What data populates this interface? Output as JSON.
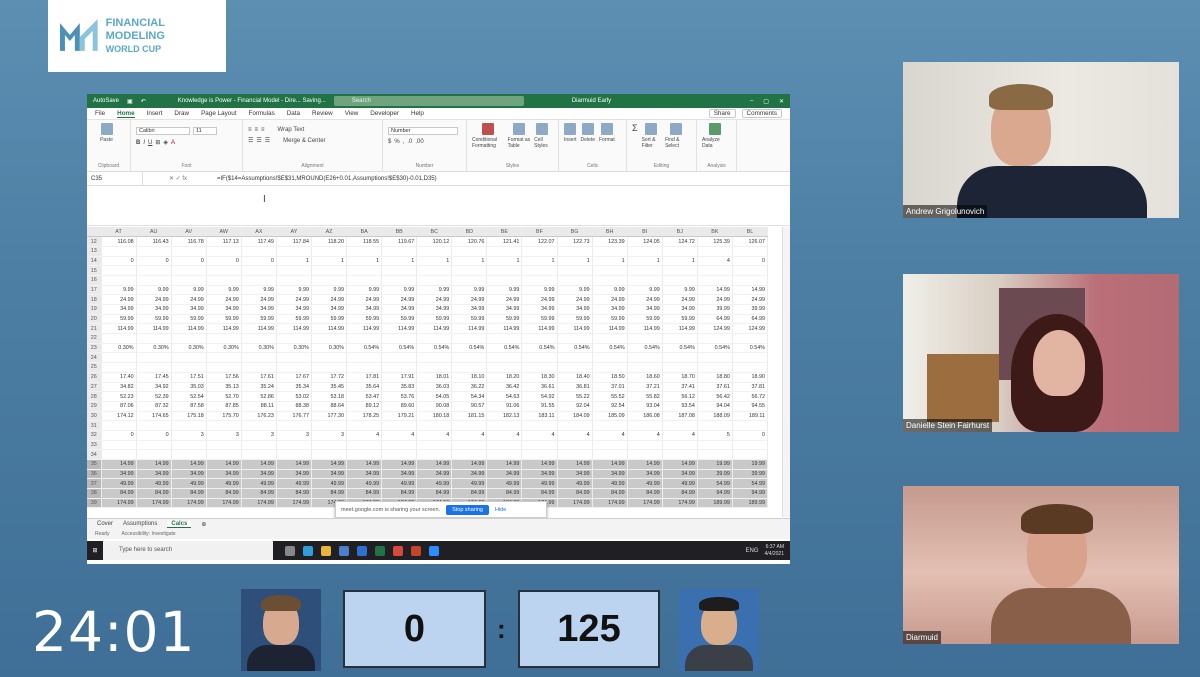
{
  "logo": {
    "line1": "FINANCIAL MODELING",
    "line2": "WORLD CUP"
  },
  "excel": {
    "autosave": "AutoSave",
    "title": "Knowledge is Power - Financial Model - Dire... Saving...",
    "search_placeholder": "Search",
    "user": "Diarmuid Early",
    "menu": [
      "File",
      "Home",
      "Insert",
      "Draw",
      "Page Layout",
      "Formulas",
      "Data",
      "Review",
      "View",
      "Developer",
      "Help"
    ],
    "share": "Share",
    "comments": "Comments",
    "ribbon": {
      "clipboard": "Clipboard",
      "paste": "Paste",
      "font_name": "Calibri",
      "font_size": "11",
      "font": "Font",
      "wrap": "Wrap Text",
      "merge": "Merge & Center",
      "alignment": "Alignment",
      "number_format": "Number",
      "number": "Number",
      "conditional": "Conditional Formatting",
      "format_table": "Format as Table",
      "cell_styles": "Cell Styles",
      "styles": "Styles",
      "insert": "Insert",
      "delete": "Delete",
      "format": "Format",
      "cells": "Cells",
      "sort": "Sort & Filter",
      "find": "Find & Select",
      "editing": "Editing",
      "analyze": "Analyze Data",
      "analysis": "Analysis"
    },
    "namebox": "C35",
    "formula": "=IF($14=Assumptions!$E$31,MROUND(E26+0.01,Assumptions!$E$30)-0.01,D35)",
    "columns": [
      "AT",
      "AU",
      "AV",
      "AW",
      "AX",
      "AY",
      "AZ",
      "BA",
      "BB",
      "BC",
      "BD",
      "BE",
      "BF",
      "BG",
      "BH",
      "BI",
      "BJ",
      "BK",
      "BL"
    ],
    "rows": [
      {
        "n": "12",
        "v": [
          "116.08",
          "116.43",
          "116.78",
          "117.13",
          "117.49",
          "117.84",
          "118.20",
          "118.55",
          "119.67",
          "120.12",
          "120.76",
          "121.41",
          "122.07",
          "122.73",
          "123.39",
          "124.05",
          "124.72",
          "125.39",
          "126.07"
        ]
      },
      {
        "n": "13",
        "v": [
          "",
          "",
          "",
          "",
          "",
          "",
          "",
          "",
          "",
          "",
          "",
          "",
          "",
          "",
          "",
          "",
          "",
          "",
          ""
        ]
      },
      {
        "n": "14",
        "v": [
          "0",
          "0",
          "0",
          "0",
          "0",
          "1",
          "1",
          "1",
          "1",
          "1",
          "1",
          "1",
          "1",
          "1",
          "1",
          "1",
          "1",
          "4",
          "0"
        ]
      },
      {
        "n": "15",
        "v": [
          "",
          "",
          "",
          "",
          "",
          "",
          "",
          "",
          "",
          "",
          "",
          "",
          "",
          "",
          "",
          "",
          "",
          "",
          ""
        ]
      },
      {
        "n": "16",
        "v": [
          "",
          "",
          "",
          "",
          "",
          "",
          "",
          "",
          "",
          "",
          "",
          "",
          "",
          "",
          "",
          "",
          "",
          "",
          ""
        ]
      },
      {
        "n": "17",
        "v": [
          "9.99",
          "9.99",
          "9.99",
          "9.99",
          "9.99",
          "9.99",
          "9.99",
          "9.99",
          "9.99",
          "9.99",
          "9.99",
          "9.99",
          "9.99",
          "9.99",
          "9.99",
          "9.99",
          "9.99",
          "14.99",
          "14.99"
        ]
      },
      {
        "n": "18",
        "v": [
          "24.99",
          "24.99",
          "24.99",
          "24.99",
          "24.99",
          "24.99",
          "24.99",
          "24.99",
          "24.99",
          "24.99",
          "24.99",
          "24.99",
          "24.99",
          "24.99",
          "24.99",
          "24.99",
          "24.99",
          "24.99",
          "24.99"
        ]
      },
      {
        "n": "19",
        "v": [
          "34.99",
          "34.99",
          "34.99",
          "34.99",
          "34.99",
          "34.99",
          "34.99",
          "34.99",
          "34.99",
          "34.99",
          "34.99",
          "34.99",
          "34.99",
          "34.99",
          "34.99",
          "34.99",
          "34.99",
          "39.99",
          "39.99"
        ]
      },
      {
        "n": "20",
        "v": [
          "59.99",
          "59.99",
          "59.99",
          "59.99",
          "59.99",
          "59.99",
          "59.99",
          "59.99",
          "59.99",
          "59.99",
          "59.99",
          "59.99",
          "59.99",
          "59.99",
          "59.99",
          "59.99",
          "59.99",
          "64.99",
          "64.99"
        ]
      },
      {
        "n": "21",
        "v": [
          "114.99",
          "114.99",
          "114.99",
          "114.99",
          "114.99",
          "114.99",
          "114.99",
          "114.99",
          "114.99",
          "114.99",
          "114.99",
          "114.99",
          "114.99",
          "114.99",
          "114.99",
          "114.99",
          "114.99",
          "124.99",
          "124.99"
        ]
      },
      {
        "n": "22",
        "v": [
          "",
          "",
          "",
          "",
          "",
          "",
          "",
          "",
          "",
          "",
          "",
          "",
          "",
          "",
          "",
          "",
          "",
          "",
          ""
        ]
      },
      {
        "n": "23",
        "v": [
          "0.30%",
          "0.30%",
          "0.30%",
          "0.30%",
          "0.30%",
          "0.30%",
          "0.30%",
          "0.54%",
          "0.54%",
          "0.54%",
          "0.54%",
          "0.54%",
          "0.54%",
          "0.54%",
          "0.54%",
          "0.54%",
          "0.54%",
          "0.54%",
          "0.54%"
        ]
      },
      {
        "n": "24",
        "v": [
          "",
          "",
          "",
          "",
          "",
          "",
          "",
          "",
          "",
          "",
          "",
          "",
          "",
          "",
          "",
          "",
          "",
          "",
          ""
        ]
      },
      {
        "n": "25",
        "v": [
          "",
          "",
          "",
          "",
          "",
          "",
          "",
          "",
          "",
          "",
          "",
          "",
          "",
          "",
          "",
          "",
          "",
          "",
          ""
        ]
      },
      {
        "n": "26",
        "v": [
          "17.40",
          "17.45",
          "17.51",
          "17.56",
          "17.61",
          "17.67",
          "17.72",
          "17.81",
          "17.91",
          "18.01",
          "18.10",
          "18.20",
          "18.30",
          "18.40",
          "18.50",
          "18.60",
          "18.70",
          "18.80",
          "18.90"
        ]
      },
      {
        "n": "27",
        "v": [
          "34.82",
          "34.92",
          "35.03",
          "35.13",
          "35.24",
          "35.34",
          "35.45",
          "35.64",
          "35.83",
          "36.03",
          "36.22",
          "36.42",
          "36.61",
          "36.81",
          "37.01",
          "37.21",
          "37.41",
          "37.61",
          "37.81"
        ]
      },
      {
        "n": "28",
        "v": [
          "52.23",
          "52.39",
          "52.54",
          "52.70",
          "52.86",
          "53.02",
          "53.18",
          "53.47",
          "53.76",
          "54.05",
          "54.34",
          "54.63",
          "54.92",
          "55.22",
          "55.52",
          "55.82",
          "56.12",
          "56.42",
          "56.72"
        ]
      },
      {
        "n": "29",
        "v": [
          "87.06",
          "87.32",
          "87.58",
          "87.85",
          "88.11",
          "88.38",
          "88.64",
          "89.12",
          "89.60",
          "90.08",
          "90.57",
          "91.06",
          "91.55",
          "92.04",
          "92.54",
          "93.04",
          "93.54",
          "94.04",
          "94.55"
        ]
      },
      {
        "n": "30",
        "v": [
          "174.12",
          "174.65",
          "175.18",
          "175.70",
          "176.23",
          "176.77",
          "177.30",
          "178.25",
          "179.21",
          "180.18",
          "181.15",
          "182.13",
          "183.11",
          "184.09",
          "185.09",
          "186.08",
          "187.08",
          "188.09",
          "189.11"
        ]
      },
      {
        "n": "31",
        "v": [
          "",
          "",
          "",
          "",
          "",
          "",
          "",
          "",
          "",
          "",
          "",
          "",
          "",
          "",
          "",
          "",
          "",
          "",
          ""
        ]
      },
      {
        "n": "32",
        "v": [
          "0",
          "0",
          "3",
          "3",
          "3",
          "3",
          "3",
          "4",
          "4",
          "4",
          "4",
          "4",
          "4",
          "4",
          "4",
          "4",
          "4",
          "5",
          "0"
        ]
      },
      {
        "n": "33",
        "v": [
          "",
          "",
          "",
          "",
          "",
          "",
          "",
          "",
          "",
          "",
          "",
          "",
          "",
          "",
          "",
          "",
          "",
          "",
          ""
        ]
      },
      {
        "n": "34",
        "v": [
          "",
          "",
          "",
          "",
          "",
          "",
          "",
          "",
          "",
          "",
          "",
          "",
          "",
          "",
          "",
          "",
          "",
          "",
          ""
        ]
      },
      {
        "n": "35",
        "shade": true,
        "v": [
          "14.99",
          "14.99",
          "14.99",
          "14.99",
          "14.99",
          "14.99",
          "14.99",
          "14.99",
          "14.99",
          "14.99",
          "14.99",
          "14.99",
          "14.99",
          "14.99",
          "14.99",
          "14.99",
          "14.99",
          "19.99",
          "19.99"
        ]
      },
      {
        "n": "36",
        "shade": true,
        "v": [
          "34.99",
          "34.99",
          "34.99",
          "34.99",
          "34.99",
          "34.99",
          "34.99",
          "34.99",
          "34.99",
          "34.99",
          "34.99",
          "34.99",
          "34.99",
          "34.99",
          "34.99",
          "34.99",
          "34.99",
          "39.99",
          "39.99"
        ]
      },
      {
        "n": "37",
        "shade": true,
        "v": [
          "49.99",
          "49.99",
          "49.99",
          "49.99",
          "49.99",
          "49.99",
          "49.99",
          "49.99",
          "49.99",
          "49.99",
          "49.99",
          "49.99",
          "49.99",
          "49.99",
          "49.99",
          "49.99",
          "49.99",
          "54.99",
          "54.99"
        ]
      },
      {
        "n": "38",
        "shade": true,
        "v": [
          "84.99",
          "84.99",
          "84.99",
          "84.99",
          "84.99",
          "84.99",
          "84.99",
          "84.99",
          "84.99",
          "84.99",
          "84.99",
          "84.99",
          "84.99",
          "84.99",
          "84.99",
          "84.99",
          "84.99",
          "94.99",
          "94.99"
        ]
      },
      {
        "n": "39",
        "shade": true,
        "v": [
          "174.99",
          "174.99",
          "174.99",
          "174.99",
          "174.99",
          "174.99",
          "174.99",
          "174.99",
          "174.99",
          "174.99",
          "174.99",
          "174.99",
          "174.99",
          "174.99",
          "174.99",
          "174.99",
          "174.99",
          "189.99",
          "189.99"
        ]
      }
    ],
    "sharing": {
      "text": "meet.google.com is sharing your screen.",
      "stop": "Stop sharing",
      "hide": "Hide"
    },
    "tabs": [
      "Cover",
      "Assumptions",
      "Calcs"
    ],
    "status": {
      "ready": "Ready",
      "accessibility": "Accessibility: Investigate"
    },
    "taskbar": {
      "search": "Type here to search",
      "lang": "ENG",
      "time": "6:37 AM",
      "date": "4/4/2021"
    }
  },
  "participants": [
    "Andrew Grigolunovich",
    "Danielle Stein Fairhurst",
    "Diarmuid"
  ],
  "timer": "24:01",
  "scores": {
    "left": "0",
    "right": "125",
    "sep": ":"
  }
}
